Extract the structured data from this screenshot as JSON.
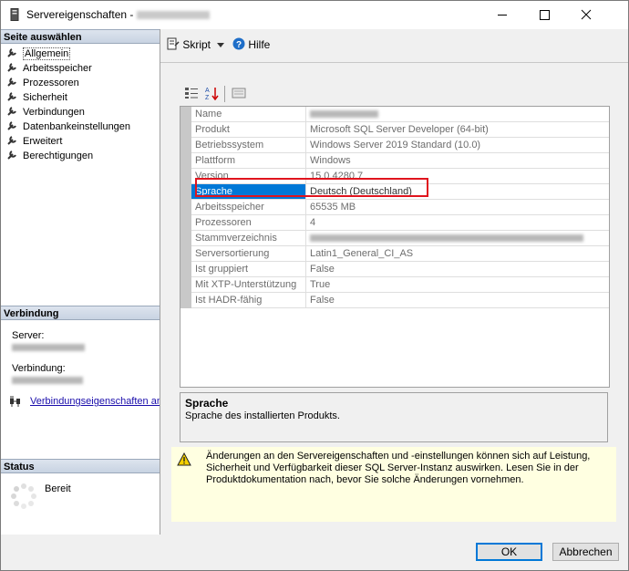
{
  "window": {
    "title": "Servereigenschaften -"
  },
  "left_panel": {
    "select_page_header": "Seite auswählen",
    "pages": [
      {
        "label": "Allgemein"
      },
      {
        "label": "Arbeitsspeicher"
      },
      {
        "label": "Prozessoren"
      },
      {
        "label": "Sicherheit"
      },
      {
        "label": "Verbindungen"
      },
      {
        "label": "Datenbankeinstellungen"
      },
      {
        "label": "Erweitert"
      },
      {
        "label": "Berechtigungen"
      }
    ],
    "connection_header": "Verbindung",
    "server_label": "Server:",
    "connection_label": "Verbindung:",
    "connection_link": "Verbindungseigenschaften anzeigen",
    "status_header": "Status",
    "status_text": "Bereit"
  },
  "toolbar": {
    "script_label": "Skript",
    "help_label": "Hilfe"
  },
  "properties": [
    {
      "key": "Name",
      "value": ""
    },
    {
      "key": "Produkt",
      "value": "Microsoft SQL Server Developer (64-bit)"
    },
    {
      "key": "Betriebssystem",
      "value": "Windows Server 2019 Standard (10.0)"
    },
    {
      "key": "Plattform",
      "value": "Windows"
    },
    {
      "key": "Version",
      "value": "15.0.4280.7"
    },
    {
      "key": "Sprache",
      "value": "Deutsch (Deutschland)"
    },
    {
      "key": "Arbeitsspeicher",
      "value": "65535 MB"
    },
    {
      "key": "Prozessoren",
      "value": "4"
    },
    {
      "key": "Stammverzeichnis",
      "value": ""
    },
    {
      "key": "Serversortierung",
      "value": "Latin1_General_CI_AS"
    },
    {
      "key": "Ist gruppiert",
      "value": "False"
    },
    {
      "key": "Mit XTP-Unterstützung",
      "value": "True"
    },
    {
      "key": "Ist HADR-fähig",
      "value": "False"
    }
  ],
  "description": {
    "title": "Sprache",
    "text": "Sprache des installierten Produkts."
  },
  "warning": {
    "text": "Änderungen an den Servereigenschaften und -einstellungen können sich auf Leistung, Sicherheit und Verfügbarkeit dieser SQL Server-Instanz auswirken. Lesen Sie in der Produktdokumentation nach, bevor Sie solche Änderungen vornehmen."
  },
  "buttons": {
    "ok": "OK",
    "cancel": "Abbrechen"
  },
  "colors": {
    "selection": "#0078d7",
    "highlight_box": "#e0141e",
    "warning_bg": "#ffffe1"
  }
}
